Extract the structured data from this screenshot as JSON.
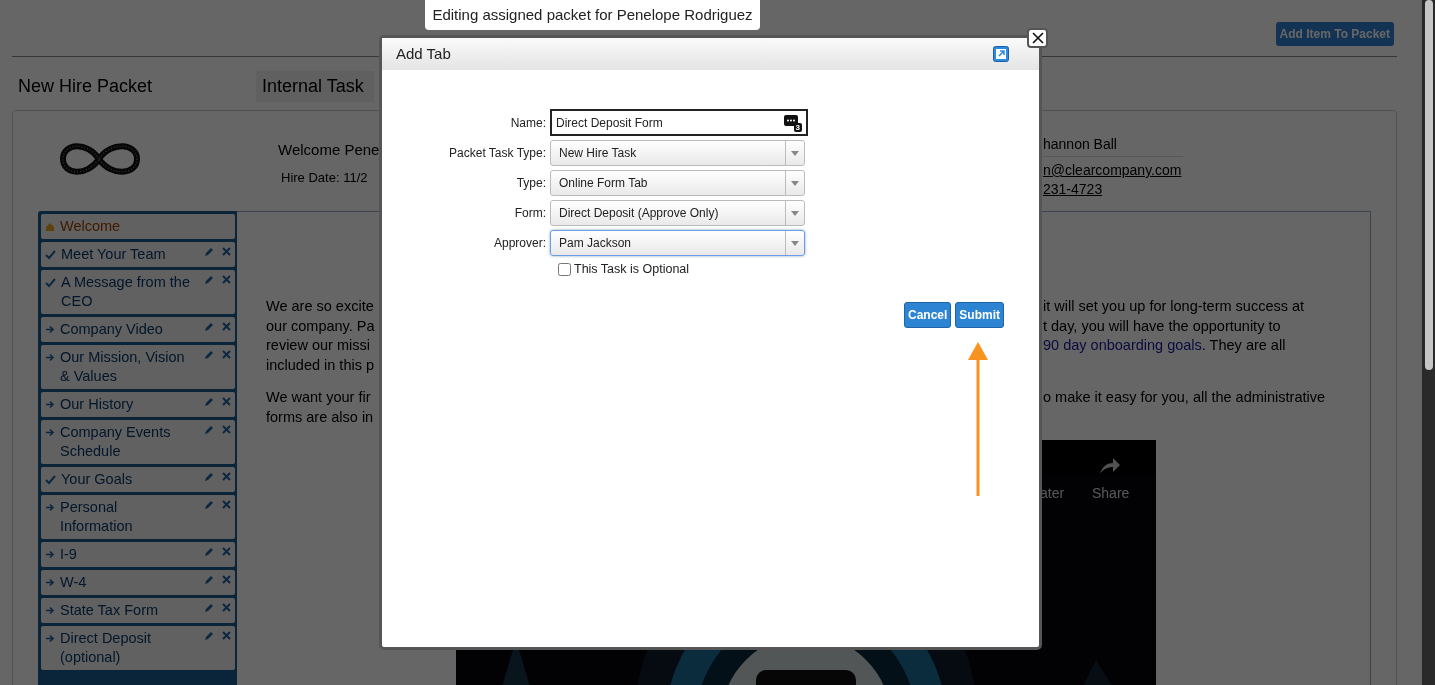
{
  "tooltip": "Editing assigned packet for Penelope Rodriguez",
  "page": {
    "add_button": "Add Item To Packet",
    "title": "New Hire Packet",
    "tab": "Internal Task",
    "welcome": "Welcome Pene",
    "hire_date": "Hire Date: 11/2",
    "contact": [
      {
        "text": "hannon Ball",
        "link": false
      },
      {
        "text": "n@clearcompany.com",
        "link": true
      },
      {
        "text": "231-4723",
        "link": true
      }
    ],
    "sidebar": [
      {
        "label": "Welcome",
        "kind": "home",
        "selected": true
      },
      {
        "label": "Meet Your Team",
        "kind": "done",
        "selected": false
      },
      {
        "label": "A Message from the CEO",
        "kind": "done",
        "selected": false
      },
      {
        "label": "Company Video",
        "kind": "todo",
        "selected": false
      },
      {
        "label": "Our Mission, Vision & Values",
        "kind": "todo",
        "selected": false
      },
      {
        "label": "Our History",
        "kind": "todo",
        "selected": false
      },
      {
        "label": "Company Events Schedule",
        "kind": "todo",
        "selected": false
      },
      {
        "label": "Your Goals",
        "kind": "done",
        "selected": false
      },
      {
        "label": "Personal Information",
        "kind": "todo",
        "selected": false
      },
      {
        "label": "I-9",
        "kind": "todo",
        "selected": false
      },
      {
        "label": "W-4",
        "kind": "todo",
        "selected": false
      },
      {
        "label": "State Tax Form",
        "kind": "todo",
        "selected": false
      },
      {
        "label": "Direct Deposit (optional)",
        "kind": "todo",
        "selected": false
      }
    ],
    "paragraphs": [
      {
        "lines": [
          {
            "left": "We are so excite",
            "right": [
              {
                "text": "it will set you up for long-term success at",
                "link": false
              }
            ]
          },
          {
            "left": "our company. Pa",
            "right": [
              {
                "text": "t day, you will have the opportunity to",
                "link": false
              }
            ]
          },
          {
            "left": "review our missi",
            "right": [
              {
                "text": "90 day onboarding goals",
                "link": true
              },
              {
                "text": ". They are all",
                "link": false
              }
            ]
          },
          {
            "left": "included in this p"
          }
        ]
      },
      {
        "lines": [
          {
            "left": "We want your fir",
            "right": [
              {
                "text": "o make it easy for you, all the administrative",
                "link": false
              }
            ]
          },
          {
            "left": "forms are also in"
          }
        ]
      }
    ],
    "video": {
      "labels": [
        "ater",
        "Share"
      ]
    }
  },
  "dialog": {
    "title": "Add Tab",
    "name": {
      "label": "Name:",
      "value": "Direct Deposit Form",
      "icon_badge": "3"
    },
    "selects": [
      {
        "label": "Packet Task Type:",
        "value": "New Hire Task",
        "focused": false
      },
      {
        "label": "Type:",
        "value": "Online Form Tab",
        "focused": false
      },
      {
        "label": "Form:",
        "value": "Direct Deposit (Approve Only)",
        "focused": false
      },
      {
        "label": "Approver:",
        "value": "Pam Jackson",
        "focused": true
      }
    ],
    "optional": {
      "label": "This Task is Optional",
      "checked": false
    },
    "buttons": [
      "Cancel",
      "Submit"
    ]
  }
}
